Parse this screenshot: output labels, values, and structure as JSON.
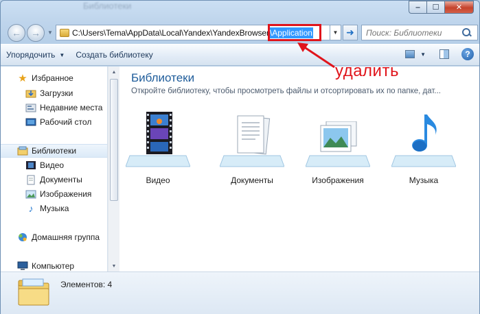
{
  "window": {
    "title_blurred": "Библиотеки"
  },
  "caption": {
    "minimize": "‒",
    "maximize": "☐",
    "close": "✕"
  },
  "address": {
    "path_prefix": "C:\\Users\\Tema\\AppData\\Local\\Yandex\\YandexBrowser",
    "selected_segment": "\\Application"
  },
  "search": {
    "placeholder": "Поиск: Библиотеки"
  },
  "toolbar": {
    "organize_label": "Упорядочить",
    "create_library_label": "Создать библиотеку"
  },
  "sidebar": {
    "items": [
      {
        "label": "Избранное",
        "icon": "star-icon"
      },
      {
        "label": "Загрузки",
        "icon": "downloads-icon"
      },
      {
        "label": "Недавние места",
        "icon": "recent-places-icon"
      },
      {
        "label": "Рабочий стол",
        "icon": "desktop-icon"
      },
      {
        "label": "Библиотеки",
        "icon": "libraries-icon"
      },
      {
        "label": "Видео",
        "icon": "video-icon"
      },
      {
        "label": "Документы",
        "icon": "documents-icon"
      },
      {
        "label": "Изображения",
        "icon": "images-icon"
      },
      {
        "label": "Музыка",
        "icon": "music-icon"
      },
      {
        "label": "Домашняя группа",
        "icon": "homegroup-icon"
      },
      {
        "label": "Компьютер",
        "icon": "computer-icon"
      }
    ]
  },
  "main": {
    "title": "Библиотеки",
    "subtitle": "Откройте библиотеку, чтобы просмотреть файлы и отсортировать их по папке, дат...",
    "libraries": [
      {
        "label": "Видео",
        "icon": "video-library-icon"
      },
      {
        "label": "Документы",
        "icon": "documents-library-icon"
      },
      {
        "label": "Изображения",
        "icon": "images-library-icon"
      },
      {
        "label": "Музыка",
        "icon": "music-library-icon"
      }
    ]
  },
  "annotation": {
    "text": "удалить",
    "color": "#e0141b"
  },
  "status": {
    "text": "Элементов: 4"
  },
  "colors": {
    "selection": "#3399ff",
    "title_blue": "#1e5c9a",
    "annotation_red": "#e0141b"
  }
}
